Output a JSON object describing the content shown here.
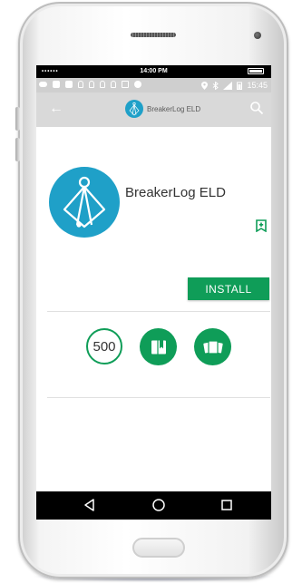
{
  "ios_status": {
    "signal": "••••••",
    "time": "14:00 PM"
  },
  "android_status": {
    "time": "15:45"
  },
  "app_bar": {
    "title": "BreakerLog ELD"
  },
  "app": {
    "name": "BreakerLog ELD",
    "install_label": "INSTALL",
    "downloads": "500"
  },
  "colors": {
    "brand_teal": "#1fa0c8",
    "play_green": "#0f9d58"
  },
  "icons": {
    "back": "arrow-left-icon",
    "search": "search-icon",
    "wishlist": "bookmark-add-icon",
    "category": "book-icon",
    "similar": "cards-icon",
    "nav_back": "triangle-back-icon",
    "nav_home": "circle-home-icon",
    "nav_recent": "square-recents-icon"
  }
}
